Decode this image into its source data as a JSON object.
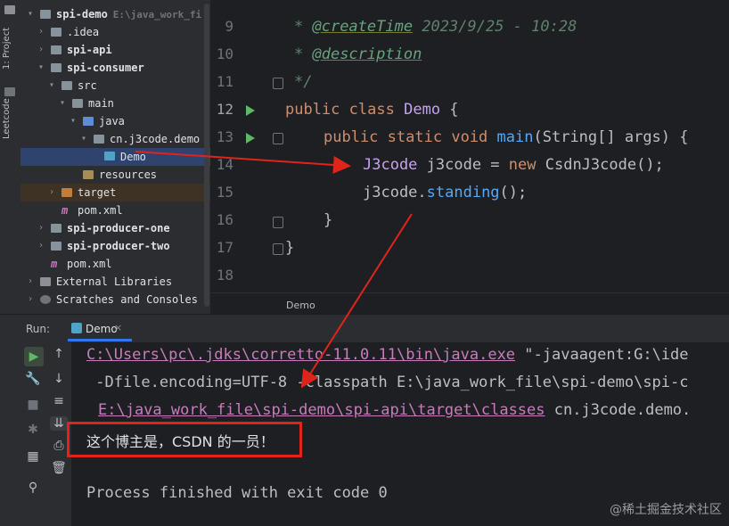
{
  "left_strip": {
    "project_tab": "1: Project",
    "leetcode_tab": "Leetcode"
  },
  "project_tree": [
    {
      "label": "spi-demo",
      "hint": "E:\\java_work_fi",
      "bold": true,
      "depth": 0,
      "chev": "▾",
      "icon": "folder"
    },
    {
      "label": ".idea",
      "depth": 1,
      "chev": "›",
      "icon": "folder"
    },
    {
      "label": "spi-api",
      "bold": true,
      "depth": 1,
      "chev": "›",
      "icon": "folder"
    },
    {
      "label": "spi-consumer",
      "bold": true,
      "depth": 1,
      "chev": "▾",
      "icon": "folder"
    },
    {
      "label": "src",
      "depth": 2,
      "chev": "▾",
      "icon": "folder"
    },
    {
      "label": "main",
      "depth": 3,
      "chev": "▾",
      "icon": "folder"
    },
    {
      "label": "java",
      "depth": 4,
      "chev": "▾",
      "icon": "folder-src"
    },
    {
      "label": "cn.j3code.demo",
      "depth": 5,
      "chev": "▾",
      "icon": "folder"
    },
    {
      "label": "Demo",
      "depth": 6,
      "chev": "",
      "icon": "class"
    },
    {
      "label": "resources",
      "depth": 4,
      "chev": "",
      "icon": "folder-res"
    },
    {
      "label": "target",
      "depth": 2,
      "chev": "›",
      "icon": "folder-tgt"
    },
    {
      "label": "pom.xml",
      "depth": 2,
      "chev": "",
      "icon": "maven"
    },
    {
      "label": "spi-producer-one",
      "bold": true,
      "depth": 1,
      "chev": "›",
      "icon": "folder"
    },
    {
      "label": "spi-producer-two",
      "bold": true,
      "depth": 1,
      "chev": "›",
      "icon": "folder"
    },
    {
      "label": "pom.xml",
      "depth": 1,
      "chev": "",
      "icon": "maven"
    },
    {
      "label": "External Libraries",
      "depth": 0,
      "chev": "›",
      "icon": "lib"
    },
    {
      "label": "Scratches and Consoles",
      "depth": 0,
      "chev": "›",
      "icon": "scratch"
    }
  ],
  "editor": {
    "line_numbers": [
      "9",
      "10",
      "11",
      "12",
      "13",
      "14",
      "15",
      "16",
      "17",
      "18"
    ],
    "doc_createtime_tag": "@createTime",
    "doc_createtime_value": " 2023/9/25 - 10:28",
    "doc_description_tag": "@description",
    "doc_star": "* ",
    "doc_end": "*/",
    "kw_public": "public",
    "kw_class": "class",
    "class_name": "Demo",
    "brace_open": " {",
    "kw_static": "static",
    "kw_void": "void",
    "method_main": "main",
    "main_params": "(String[] args) {",
    "var_type": "J3code",
    "var_decl": " j3code = ",
    "kw_new": "new",
    "ctor": " CsdnJ3code();",
    "call_target": "j3code.",
    "call_method": "standing",
    "call_end": "();",
    "brace_close": "}",
    "breadcrumb": "Demo"
  },
  "run": {
    "label": "Run:",
    "tab": "Demo",
    "tab_close": "×",
    "console_lines": {
      "java_exe": "C:\\Users\\pc\\.jdks\\corretto-11.0.11\\bin\\java.exe",
      "javaagent": " \"-javaagent:G:\\ide",
      "line2": " -Dfile.encoding=UTF-8 -classpath E:\\java_work_file\\spi-demo\\spi-c",
      "classes_path": "E:\\java_work_file\\spi-demo\\spi-api\\target\\classes",
      "main_class": " cn.j3code.demo.",
      "output": "这个博主是，CSDN 的一员！",
      "exit": "Process finished with exit code 0"
    }
  },
  "watermark": "@稀土掘金技术社区"
}
